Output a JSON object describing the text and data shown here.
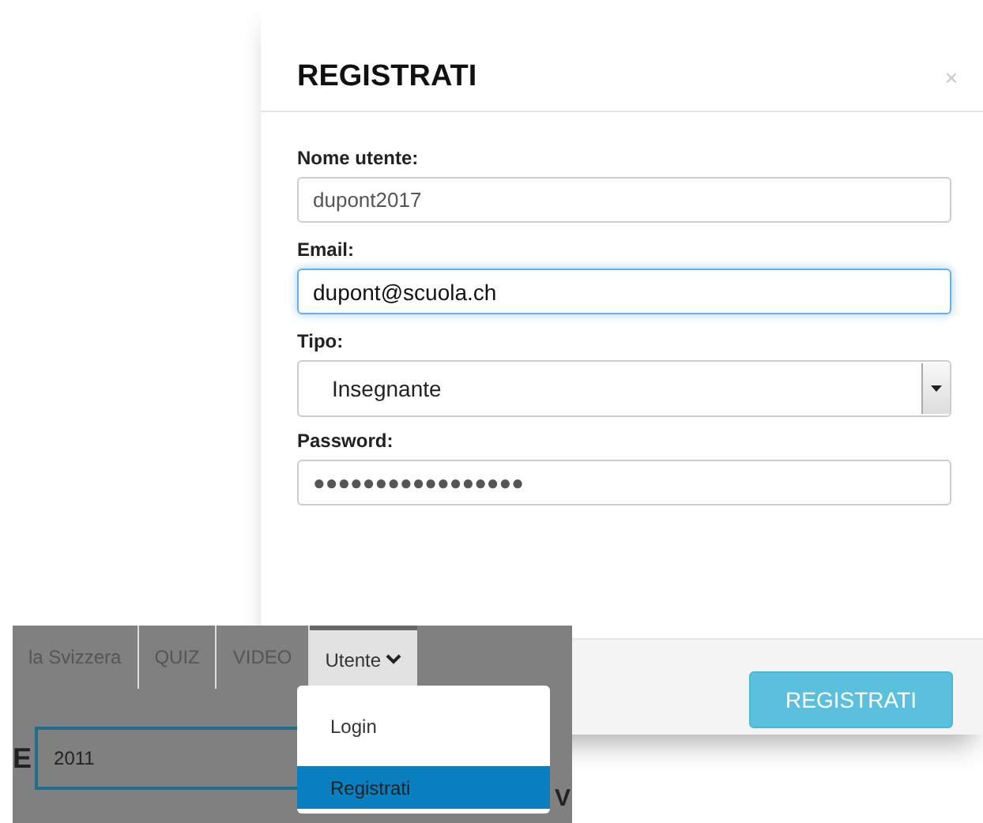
{
  "modal": {
    "title": "REGISTRATI",
    "close": "×",
    "fields": [
      {
        "kind": "text",
        "label": "Nome utente:",
        "value": "dupont2017"
      },
      {
        "kind": "text",
        "label": "Email:",
        "value": "dupont@scuola.ch",
        "focused": true
      },
      {
        "kind": "select",
        "label": "Tipo:",
        "value": "Insegnante"
      },
      {
        "kind": "text",
        "label": "Password:",
        "value": "●●●●●●●●●●●●●●●●●"
      }
    ],
    "submit": "REGISTRATI"
  },
  "nav": {
    "tabs": [
      {
        "label": "la Svizzera",
        "selected": false
      },
      {
        "label": "QUIZ",
        "selected": false
      },
      {
        "label": "VIDEO",
        "selected": false
      },
      {
        "label": "Utente",
        "selected": true
      }
    ],
    "menu": [
      {
        "label": "Login",
        "selected": false
      },
      {
        "label": "Registrati",
        "selected": true
      }
    ],
    "left_fragment": "E",
    "year_field": "2011",
    "right_fragment": "V"
  }
}
